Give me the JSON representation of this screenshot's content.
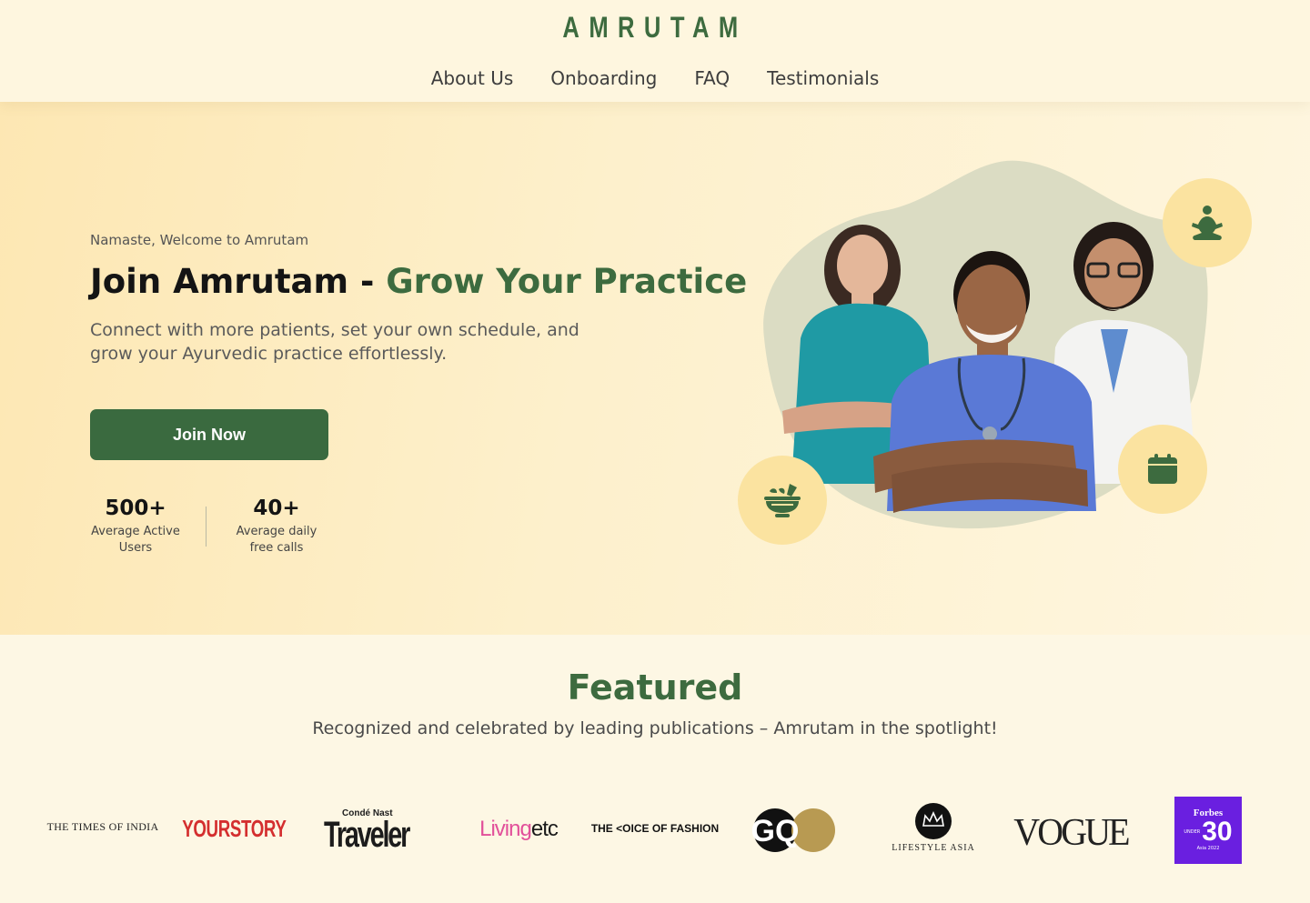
{
  "header": {
    "logo": "AMRUTAM",
    "nav": [
      "About Us",
      "Onboarding",
      "FAQ",
      "Testimonials"
    ]
  },
  "hero": {
    "greeting": "Namaste, Welcome to Amrutam",
    "title_main": "Join Amrutam - ",
    "title_accent": "Grow Your Practice",
    "subtitle": "Connect with more patients, set your own schedule, and grow your Ayurvedic practice effortlessly.",
    "cta": "Join Now",
    "stats": [
      {
        "value": "500+",
        "label": "Average Active Users"
      },
      {
        "value": "40+",
        "label": "Average daily free calls"
      }
    ],
    "icons": [
      "meditation-icon",
      "calendar-icon",
      "mortar-pestle-icon"
    ]
  },
  "featured": {
    "title": "Featured",
    "subtitle": "Recognized and celebrated by leading publications – Amrutam in the spotlight!",
    "publications": {
      "toi": "THE TIMES OF INDIA",
      "yourstory": "YOURSTORY",
      "traveler_top": "Condé Nast",
      "traveler": "Traveler",
      "livingetc_a": "Living",
      "livingetc_b": "etc",
      "vof": "THE <OICE OF FASHION",
      "gq": "GQ",
      "lifestyle": "LIFESTYLE ASIA",
      "vogue": "VOGUE",
      "forbes_top": "Forbes",
      "forbes_under": "UNDER",
      "forbes_num": "30",
      "forbes_bottom": "Asia 2022"
    }
  },
  "colors": {
    "brand_green": "#3d6b3f",
    "hero_bg": "#fde7b3",
    "icon_bg": "#fbe3a0",
    "forbes_purple": "#6a1fe0",
    "yourstory_red": "#d42f2f",
    "livingetc_pink": "#e2509a"
  }
}
